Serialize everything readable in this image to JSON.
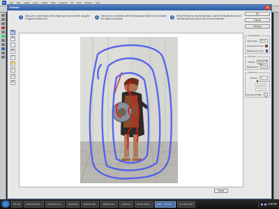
{
  "app": {
    "logo": "Ps",
    "menu": [
      "File",
      "Edit",
      "Image",
      "Layer",
      "Select",
      "Filter",
      "Analysis",
      "3D",
      "View",
      "Window",
      "Help"
    ]
  },
  "dialog": {
    "title": "Extract",
    "close": "✕",
    "hints": [
      {
        "number": "1",
        "text": "Click one or more times on the object you want to select using the Foreground Brush tool."
      },
      {
        "number": "2",
        "text": "Click one or more times with the Background Brush tool to indicate the regions to exclude."
      },
      {
        "number": "3",
        "text": "Press Preview to view the selection. Use the Selection Brush and Smoothing Brush tools to fine-tune the selection."
      }
    ],
    "tool_icons": [
      "foreground-brush-icon",
      "background-brush-icon",
      "point-eraser-icon",
      "selection-brush-icon",
      "smoothing-brush-icon",
      "hand-icon",
      "zoom-icon",
      "eraser-icon",
      "cross-icon"
    ],
    "tool_glyphs": [
      "✎",
      "✎",
      "◌",
      "✎",
      "≈",
      "✋",
      "⌕",
      "▭",
      "✕"
    ],
    "buttons": {
      "ok": "OK",
      "cancel": "Cancel",
      "preview": "Preview",
      "reset": "Reset"
    },
    "tool_options": {
      "title": "Tool Options",
      "brush_size_label": "Brush Size:",
      "brush_size_value": "20 px",
      "foreground_label": "Foreground Color:",
      "background_label": "Background Color:"
    },
    "preview_options": {
      "title": "Preview",
      "display_label": "Display:",
      "display_value": "Selection Area",
      "background_label": "Background:",
      "background_value": "None"
    },
    "touch_up": {
      "title": "Touch Up",
      "feather_label": "Feather:",
      "feather_value": "0",
      "fill_holes": "Fill Holes",
      "clear": "Clear",
      "smoothing_label": "Smoothing Width:",
      "smoothing_value": "1 px"
    }
  },
  "colors": {
    "foreground_swatch": "#e01010",
    "background_swatch": "#1020c8",
    "highlight_stroke": "#4a59ef",
    "foreground_stroke": "#d21a1a"
  },
  "taskbar": {
    "tasks": [
      "PC-Sell",
      "Adobe Photosh...",
      "Photoshop Tut...",
      "Download",
      "Windows Wo...",
      "Windows Ex...",
      "Lightroom",
      "Internet Explo...",
      "Editor - Photosh...",
      "Tips and Tricks"
    ],
    "active_index": 8,
    "clock": "3:48 PM"
  }
}
